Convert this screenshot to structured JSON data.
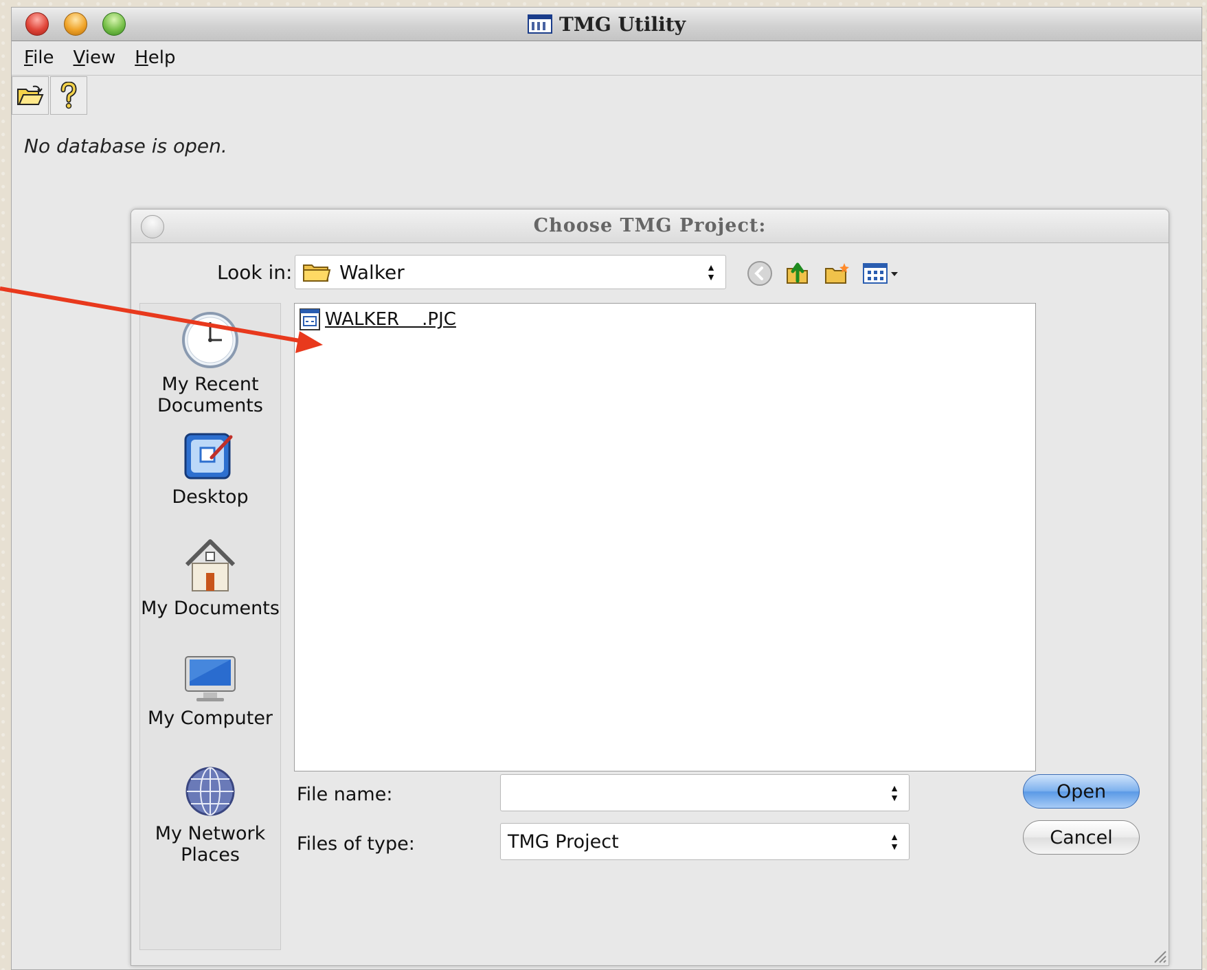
{
  "window": {
    "title": "TMG Utility"
  },
  "menu": [
    {
      "label": "File"
    },
    {
      "label": "View"
    },
    {
      "label": "Help"
    }
  ],
  "status": {
    "text": "No database is open."
  },
  "dialog": {
    "title": "Choose TMG Project:",
    "look_in_label": "Look in:",
    "look_in_value": "Walker",
    "places": [
      {
        "label_lines": [
          "My Recent",
          "Documents"
        ],
        "icon": "clock-icon"
      },
      {
        "label_lines": [
          "Desktop"
        ],
        "icon": "desktop-icon"
      },
      {
        "label_lines": [
          "My Documents"
        ],
        "icon": "house-icon"
      },
      {
        "label_lines": [
          "My Computer"
        ],
        "icon": "computer-icon"
      },
      {
        "label_lines": [
          "My Network",
          "Places"
        ],
        "icon": "globe-icon"
      }
    ],
    "files": [
      {
        "name": "WALKER    .PJC"
      }
    ],
    "file_name_label": "File name:",
    "file_name_value": "",
    "files_of_type_label": "Files of type:",
    "files_of_type_value": "TMG Project",
    "open_label": "Open",
    "cancel_label": "Cancel"
  },
  "colors": {
    "annotation_arrow": "#e8391d",
    "open_button": "#6aa6ec"
  }
}
